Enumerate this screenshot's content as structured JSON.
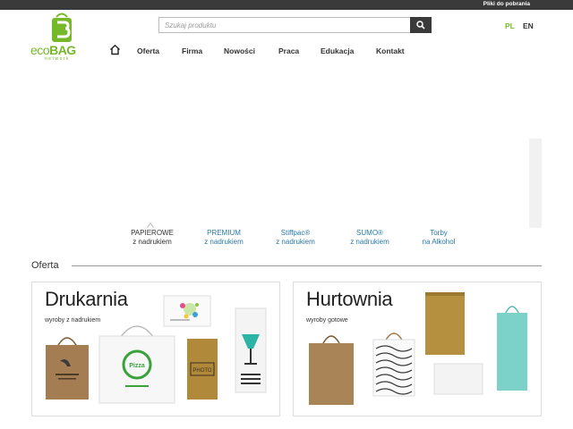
{
  "topbar": {
    "downloads_label": "Pliki do pobrania"
  },
  "logo": {
    "word_eco": "eco",
    "word_bag": "BAG",
    "sub": "network"
  },
  "search": {
    "placeholder": "Szukaj produktu"
  },
  "lang": {
    "pl": "PL",
    "en": "EN"
  },
  "nav": {
    "items": [
      "Oferta",
      "Firma",
      "Nowości",
      "Praca",
      "Edukacja",
      "Kontakt"
    ]
  },
  "tabs": [
    {
      "line1": "PAPIEROWE",
      "line2": "z nadrukiem"
    },
    {
      "line1": "PREMIUM",
      "line2": "z nadrukiem"
    },
    {
      "line1": "Stiffpac®",
      "line2": "z nadrukiem"
    },
    {
      "line1": "SUMO®",
      "line2": "z nadrukiem"
    },
    {
      "line1": "Torby",
      "line2": "na Alkohol"
    }
  ],
  "section": {
    "title": "Oferta"
  },
  "cards": [
    {
      "title": "Drukarnia",
      "subtitle": "wyroby z nadrukiem"
    },
    {
      "title": "Hurtownia",
      "subtitle": "wyroby gotowe"
    }
  ],
  "colors": {
    "accent": "#77b82a",
    "link": "#2a79a8",
    "topbar": "#3a3a3a",
    "kraft": "#a07a4e"
  },
  "icons": [
    "home-icon",
    "search-icon",
    "dropdown-caret-icon"
  ]
}
